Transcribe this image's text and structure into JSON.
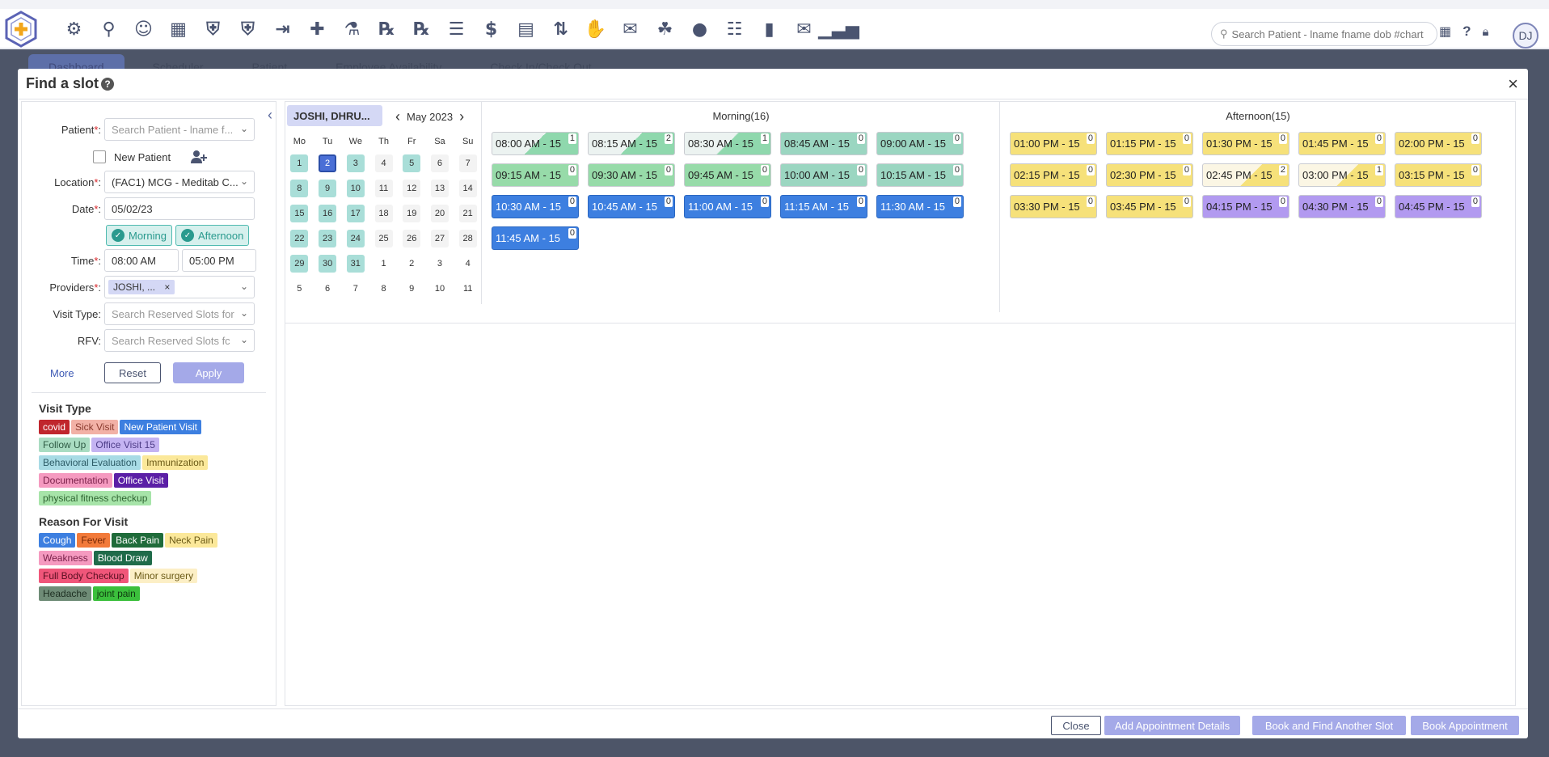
{
  "topbar": {
    "icons": [
      "gear-icon",
      "search-icon",
      "user-icon",
      "calendar-icon",
      "user-shield-icon",
      "shield-check-icon",
      "sign-in-icon",
      "clipboard-plus-icon",
      "flask-icon",
      "rx-icon",
      "rx-refill-icon",
      "document-icon",
      "dollar-icon",
      "invoice-dollar-icon",
      "dollar-exchange-icon",
      "hand-money-icon",
      "envelope-dollar-icon",
      "hands-dollar-icon",
      "money-bag-icon",
      "ledger-icon",
      "book-icon",
      "inbox-icon",
      "analytics-icon"
    ],
    "search_placeholder": "Search Patient - lname fname dob #chart",
    "avatar_initials": "DJ"
  },
  "background_tabs": [
    "Dashboard",
    "Scheduler",
    "Patient",
    "Employee Availability",
    "Check In/Check Out"
  ],
  "modal": {
    "title": "Find a slot",
    "help": "?",
    "close_glyph": "×"
  },
  "form": {
    "patient_label": "Patient",
    "patient_placeholder": "Search Patient - lname f...",
    "new_patient_label": "New Patient",
    "location_label": "Location",
    "location_value": "(FAC1) MCG - Meditab C...",
    "date_label": "Date",
    "date_value": "05/02/23",
    "morning_label": "Morning",
    "afternoon_label": "Afternoon",
    "time_label": "Time",
    "time_from": "08:00 AM",
    "time_to": "05:00 PM",
    "providers_label": "Providers",
    "provider_chip": "JOSHI, ...",
    "chip_remove": "×",
    "visit_type_label": "Visit Type:",
    "visit_type_placeholder": "Search Reserved Slots for",
    "rfv_label": "RFV:",
    "rfv_placeholder": "Search Reserved Slots fc",
    "more_label": "More",
    "reset_label": "Reset",
    "apply_label": "Apply",
    "req_mark": "*",
    "colon": ":"
  },
  "legend": {
    "visit_type_title": "Visit Type",
    "visit_types": [
      {
        "label": "covid",
        "bg": "#c0262d",
        "fg": "#ffffff"
      },
      {
        "label": "Sick Visit",
        "bg": "#f2b1a6",
        "fg": "#8a3a2e"
      },
      {
        "label": "New Patient Visit",
        "bg": "#3d7fe0",
        "fg": "#ffffff"
      },
      {
        "label": "Follow Up",
        "bg": "#a9dcc2",
        "fg": "#2f5b45"
      },
      {
        "label": "Office Visit 15",
        "bg": "#c4b3f2",
        "fg": "#4d3c87"
      },
      {
        "label": "Behavioral Evaluation",
        "bg": "#a8dbe5",
        "fg": "#2c5b66"
      },
      {
        "label": "Immunization",
        "bg": "#fbe89a",
        "fg": "#6b5a16"
      },
      {
        "label": "Documentation",
        "bg": "#f59ac0",
        "fg": "#7a2049"
      },
      {
        "label": "Office Visit",
        "bg": "#5b1fa6",
        "fg": "#ffffff"
      },
      {
        "label": "physical fitness checkup",
        "bg": "#a7e4a9",
        "fg": "#2e6431"
      }
    ],
    "rfv_title": "Reason For Visit",
    "rfvs": [
      {
        "label": "Cough",
        "bg": "#3d7fe0",
        "fg": "#ffffff"
      },
      {
        "label": "Fever",
        "bg": "#f27a3a",
        "fg": "#7a2a06"
      },
      {
        "label": "Back Pain",
        "bg": "#1f6b3a",
        "fg": "#ffffff"
      },
      {
        "label": "Neck Pain",
        "bg": "#fbe89a",
        "fg": "#6b5a16"
      },
      {
        "label": "Weakness",
        "bg": "#f59ac0",
        "fg": "#7a2049"
      },
      {
        "label": "Blood Draw",
        "bg": "#1f6b4a",
        "fg": "#ffffff"
      },
      {
        "label": "Full Body Checkup",
        "bg": "#f0567a",
        "fg": "#5a0f22"
      },
      {
        "label": "Minor surgery",
        "bg": "#fcefc6",
        "fg": "#6b5a16"
      },
      {
        "label": "Headache",
        "bg": "#6f8c77",
        "fg": "#1e2f22"
      },
      {
        "label": "joint pain",
        "bg": "#3bbf3c",
        "fg": "#0f3b10"
      }
    ]
  },
  "calendar": {
    "provider_tab": "JOSHI, DHRU...",
    "month": "May 2023",
    "prev": "‹",
    "next": "›",
    "weekdays": [
      "Mo",
      "Tu",
      "We",
      "Th",
      "Fr",
      "Sa",
      "Su"
    ],
    "weeks": [
      [
        {
          "d": "1",
          "s": "a"
        },
        {
          "d": "2",
          "s": "sel"
        },
        {
          "d": "3",
          "s": "a"
        },
        {
          "d": "4",
          "s": "n"
        },
        {
          "d": "5",
          "s": "a"
        },
        {
          "d": "6",
          "s": "n"
        },
        {
          "d": "7",
          "s": "n"
        }
      ],
      [
        {
          "d": "8",
          "s": "a"
        },
        {
          "d": "9",
          "s": "a"
        },
        {
          "d": "10",
          "s": "a"
        },
        {
          "d": "11",
          "s": "n"
        },
        {
          "d": "12",
          "s": "n"
        },
        {
          "d": "13",
          "s": "n"
        },
        {
          "d": "14",
          "s": "n"
        }
      ],
      [
        {
          "d": "15",
          "s": "a"
        },
        {
          "d": "16",
          "s": "a"
        },
        {
          "d": "17",
          "s": "a"
        },
        {
          "d": "18",
          "s": "n"
        },
        {
          "d": "19",
          "s": "n"
        },
        {
          "d": "20",
          "s": "n"
        },
        {
          "d": "21",
          "s": "n"
        }
      ],
      [
        {
          "d": "22",
          "s": "a"
        },
        {
          "d": "23",
          "s": "a"
        },
        {
          "d": "24",
          "s": "a"
        },
        {
          "d": "25",
          "s": "n"
        },
        {
          "d": "26",
          "s": "n"
        },
        {
          "d": "27",
          "s": "n"
        },
        {
          "d": "28",
          "s": "n"
        }
      ],
      [
        {
          "d": "29",
          "s": "a"
        },
        {
          "d": "30",
          "s": "a"
        },
        {
          "d": "31",
          "s": "a"
        },
        {
          "d": "1",
          "s": "x"
        },
        {
          "d": "2",
          "s": "x"
        },
        {
          "d": "3",
          "s": "x"
        },
        {
          "d": "4",
          "s": "x"
        }
      ],
      [
        {
          "d": "5",
          "s": "x"
        },
        {
          "d": "6",
          "s": "x"
        },
        {
          "d": "7",
          "s": "x"
        },
        {
          "d": "8",
          "s": "x"
        },
        {
          "d": "9",
          "s": "x"
        },
        {
          "d": "10",
          "s": "x"
        },
        {
          "d": "11",
          "s": "x"
        }
      ]
    ]
  },
  "morning": {
    "title": "Morning(16)",
    "slots": [
      {
        "label": "08:00 AM - 15",
        "count": "1",
        "style": "green"
      },
      {
        "label": "08:15 AM - 15",
        "count": "2",
        "style": "green"
      },
      {
        "label": "08:30 AM - 15",
        "count": "1",
        "style": "green"
      },
      {
        "label": "08:45 AM - 15",
        "count": "0",
        "style": "tealg"
      },
      {
        "label": "09:00 AM - 15",
        "count": "0",
        "style": "tealg"
      },
      {
        "label": "09:15 AM - 15",
        "count": "0",
        "style": "lg"
      },
      {
        "label": "09:30 AM - 15",
        "count": "0",
        "style": "lg"
      },
      {
        "label": "09:45 AM - 15",
        "count": "0",
        "style": "lg"
      },
      {
        "label": "10:00 AM - 15",
        "count": "0",
        "style": "tealg"
      },
      {
        "label": "10:15 AM - 15",
        "count": "0",
        "style": "tealg"
      },
      {
        "label": "10:30 AM - 15",
        "count": "0",
        "style": "blue"
      },
      {
        "label": "10:45 AM - 15",
        "count": "0",
        "style": "blue"
      },
      {
        "label": "11:00 AM - 15",
        "count": "0",
        "style": "blue"
      },
      {
        "label": "11:15 AM - 15",
        "count": "0",
        "style": "blue"
      },
      {
        "label": "11:30 AM - 15",
        "count": "0",
        "style": "blue"
      },
      {
        "label": "11:45 AM - 15",
        "count": "0",
        "style": "blue"
      }
    ]
  },
  "afternoon": {
    "title": "Afternoon(15)",
    "slots": [
      {
        "label": "01:00 PM - 15",
        "count": "0",
        "style": "yellow"
      },
      {
        "label": "01:15 PM - 15",
        "count": "0",
        "style": "yellow"
      },
      {
        "label": "01:30 PM - 15",
        "count": "0",
        "style": "yellow"
      },
      {
        "label": "01:45 PM - 15",
        "count": "0",
        "style": "yellow"
      },
      {
        "label": "02:00 PM - 15",
        "count": "0",
        "style": "yellow"
      },
      {
        "label": "02:15 PM - 15",
        "count": "0",
        "style": "yellow"
      },
      {
        "label": "02:30 PM - 15",
        "count": "0",
        "style": "yellow"
      },
      {
        "label": "02:45 PM - 15",
        "count": "2",
        "style": "yel2"
      },
      {
        "label": "03:00 PM - 15",
        "count": "1",
        "style": "yel2"
      },
      {
        "label": "03:15 PM - 15",
        "count": "0",
        "style": "yellow"
      },
      {
        "label": "03:30 PM - 15",
        "count": "0",
        "style": "yellow"
      },
      {
        "label": "03:45 PM - 15",
        "count": "0",
        "style": "yellow"
      },
      {
        "label": "04:15 PM - 15",
        "count": "0",
        "style": "purple"
      },
      {
        "label": "04:30 PM - 15",
        "count": "0",
        "style": "purple"
      },
      {
        "label": "04:45 PM - 15",
        "count": "0",
        "style": "purple"
      }
    ]
  },
  "footer": {
    "close_label": "Close",
    "add_details_label": "Add Appointment Details",
    "book_find_label": "Book and Find Another Slot",
    "book_label": "Book Appointment"
  }
}
